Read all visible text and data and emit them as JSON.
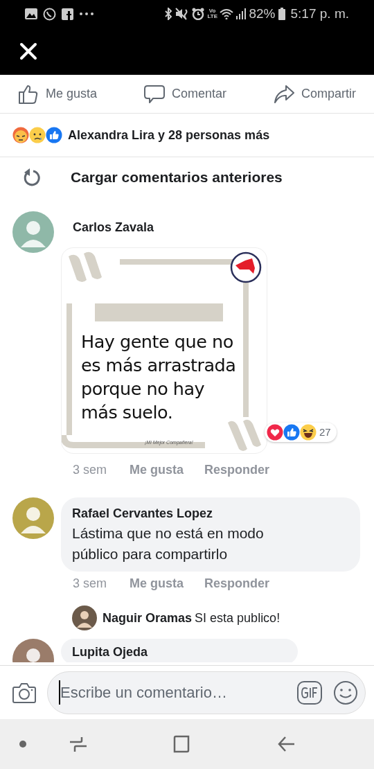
{
  "status_bar": {
    "network": "Vo LTE",
    "battery": "82%",
    "time": "5:17 p. m."
  },
  "actions": [
    {
      "label": "Me gusta",
      "kind": "like"
    },
    {
      "label": "Comentar",
      "kind": "comment"
    },
    {
      "label": "Compartir",
      "kind": "share"
    }
  ],
  "reactions_summary": {
    "text": "Alexandra Lira y 28 personas más"
  },
  "load_more": {
    "label": "Cargar comentarios anteriores"
  },
  "comments": [
    {
      "author": "Carlos Zavala",
      "kind": "image",
      "image": {
        "lines": [
          "Hay gente que no",
          "es más arrastrada",
          "porque no hay",
          "más suelo."
        ],
        "credit": "¡Mi Mejor Compañera!"
      },
      "reaction_count": "27",
      "time": "3 sem",
      "like": "Me gusta",
      "reply": "Responder"
    },
    {
      "author": "Rafael Cervantes Lopez",
      "kind": "text",
      "text": "Lástima que no está en modo público para compartirlo",
      "time": "3 sem",
      "like": "Me gusta",
      "reply": "Responder",
      "replies": [
        {
          "author": "Naguir Oramas",
          "text": "SI esta publico!"
        }
      ]
    },
    {
      "author": "Lupita Ojeda",
      "kind": "text"
    }
  ],
  "composer": {
    "placeholder": "Escribe un comentario…"
  }
}
